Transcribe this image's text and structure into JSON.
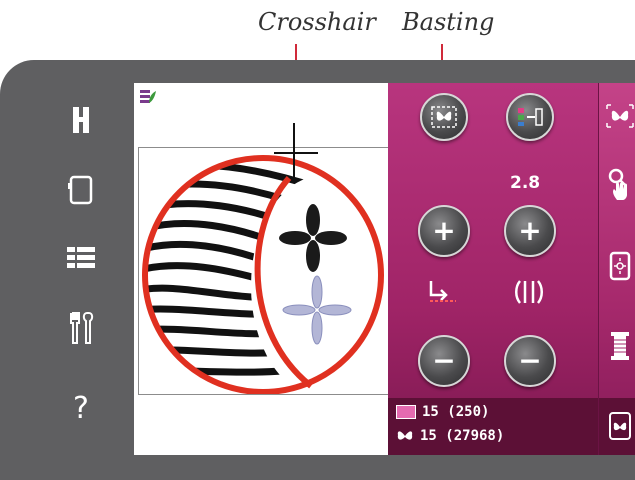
{
  "captions": {
    "crosshair": "Crosshair",
    "basting": "Basting"
  },
  "sidebar": {
    "items": [
      {
        "name": "presser-foot-icon",
        "glyph": "H"
      },
      {
        "name": "hoop-icon",
        "glyph": ""
      },
      {
        "name": "menu-list-icon",
        "glyph": ""
      },
      {
        "name": "tools-icon",
        "glyph": ""
      },
      {
        "name": "help-icon",
        "glyph": "?"
      }
    ]
  },
  "panel": {
    "stitch_value": "2.8",
    "plus": "+",
    "minus": "−"
  },
  "status": {
    "colors_count": "15 (250)",
    "stitch_count": "15 (27968)"
  },
  "colors": {
    "panel": "#a6296c",
    "status_bg": "#5c1036",
    "hoop_outline": "#e03020",
    "caption_leader": "#d02a3a"
  }
}
